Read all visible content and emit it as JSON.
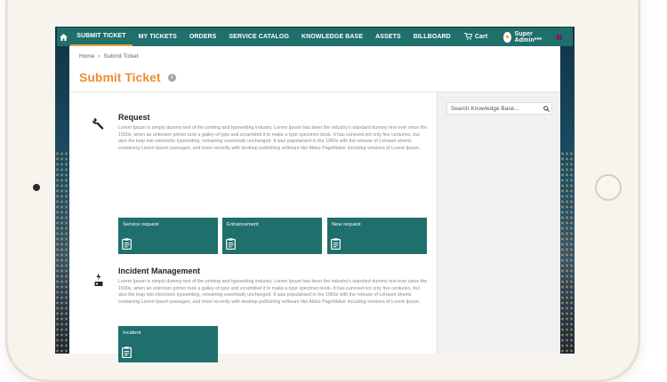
{
  "nav": {
    "items": [
      {
        "label": "SUBMIT TICKET",
        "active": true
      },
      {
        "label": "MY TICKETS",
        "active": false
      },
      {
        "label": "ORDERS",
        "active": false
      },
      {
        "label": "SERVICE CATALOG",
        "active": false
      },
      {
        "label": "KNOWLEDGE BASE",
        "active": false
      },
      {
        "label": "ASSETS",
        "active": false
      },
      {
        "label": "BILLBOARD",
        "active": false
      }
    ],
    "cart_label": "Cart",
    "user_label": "Super Admin***",
    "colors": {
      "bar": "#1f6f6c",
      "active_underline": "#f0a03c"
    }
  },
  "breadcrumb": {
    "home": "Home",
    "separator": "›",
    "current": "Submit Ticket"
  },
  "page": {
    "title": "Submit Ticket",
    "info_icon": "i",
    "title_color": "#ef8f2e"
  },
  "sidebar": {
    "search_placeholder": "Search Knowledge Base..."
  },
  "sections": [
    {
      "icon": "wrench-icon",
      "title": "Request",
      "text": "Lorem Ipsum is simply dummy text of the printing and typesetting industry. Lorem Ipsum has been the industry's standard dummy text ever since the 1500s, when an unknown printer took a galley of type and scrambled it to make a type specimen book. It has survived not only five centuries, but also the leap into electronic typesetting, remaining essentially unchanged. It was popularised in the 1960s with the release of Letraset sheets containing Lorem Ipsum passages, and more recently with desktop publishing software like Aldus PageMaker including versions of Lorem Ipsum.",
      "tiles": [
        "Service request",
        "Enhancement",
        "New request"
      ]
    },
    {
      "icon": "incident-icon",
      "title": "Incident Management",
      "text": "Lorem Ipsum is simply dummy text of the printing and typesetting industry. Lorem Ipsum has been the industry's standard dummy text ever since the 1500s, when an unknown printer took a galley of type and scrambled it to make a type specimen book. It has survived not only five centuries, but also the leap into electronic typesetting, remaining essentially unchanged. It was popularised in the 1960s with the release of Letraset sheets containing Lorem Ipsum passages, and more recently with desktop publishing software like Aldus PageMaker including versions of Lorem Ipsum.",
      "tiles": [
        "Incident"
      ]
    }
  ]
}
